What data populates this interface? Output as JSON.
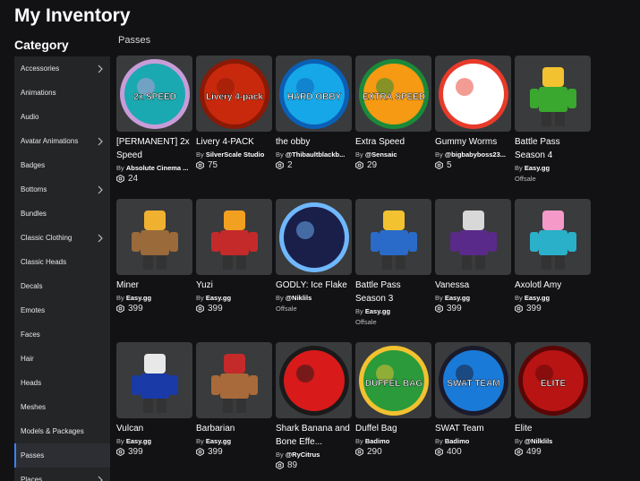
{
  "page": {
    "title": "My Inventory",
    "category_heading": "Category",
    "section_label": "Passes"
  },
  "colors": {
    "background": "#121215",
    "sidebar": "#232527",
    "active_indicator": "#3b82f6",
    "card_bg": "#393b3d"
  },
  "sidebar": {
    "items": [
      {
        "label": "Accessories",
        "chevron": true
      },
      {
        "label": "Animations",
        "chevron": false
      },
      {
        "label": "Audio",
        "chevron": false
      },
      {
        "label": "Avatar Animations",
        "chevron": true
      },
      {
        "label": "Badges",
        "chevron": false
      },
      {
        "label": "Bottoms",
        "chevron": true
      },
      {
        "label": "Bundles",
        "chevron": false
      },
      {
        "label": "Classic Clothing",
        "chevron": true
      },
      {
        "label": "Classic Heads",
        "chevron": false
      },
      {
        "label": "Decals",
        "chevron": false
      },
      {
        "label": "Emotes",
        "chevron": false
      },
      {
        "label": "Faces",
        "chevron": false
      },
      {
        "label": "Hair",
        "chevron": false
      },
      {
        "label": "Heads",
        "chevron": false
      },
      {
        "label": "Meshes",
        "chevron": false
      },
      {
        "label": "Models & Packages",
        "chevron": false
      },
      {
        "label": "Passes",
        "chevron": false,
        "active": true
      },
      {
        "label": "Places",
        "chevron": true
      }
    ]
  },
  "items": [
    {
      "name": "[PERMANENT] 2x Speed",
      "creator": "Absolute Cinema ...",
      "price": "24",
      "thumb_text": "2x SPEED",
      "thumb_color": "#1aa9b0",
      "thumb_accent": "#c89cd8"
    },
    {
      "name": "Livery 4-PACK",
      "creator": "SilverScale Studio",
      "price": "75",
      "thumb_text": "Livery 4-pack",
      "thumb_color": "#c8290c",
      "thumb_accent": "#8a1a06"
    },
    {
      "name": "the obby",
      "creator": "@Thibaultblackb...",
      "price": "2",
      "thumb_text": "HARD OBBY",
      "thumb_color": "#16a7e8",
      "thumb_accent": "#0b5fb5"
    },
    {
      "name": "Extra Speed",
      "creator": "@Sensaic",
      "price": "29",
      "thumb_text": "EXTRA SPEED",
      "thumb_color": "#f59a12",
      "thumb_accent": "#1a8a3a"
    },
    {
      "name": "Gummy Worms",
      "creator": "@bigbabyboss23...",
      "price": "5",
      "thumb_text": "",
      "thumb_color": "#ffffff",
      "thumb_accent": "#e83a2a"
    },
    {
      "name": "Battle Pass Season 4",
      "creator": "Easy.gg",
      "price": "",
      "offsale": "Offsale",
      "thumb_text": "",
      "thumb_color": "#3aa82e",
      "thumb_accent": "#f2c230"
    },
    {
      "name": "Miner",
      "creator": "Easy.gg",
      "price": "399",
      "thumb_text": "",
      "thumb_color": "#9a6a3a",
      "thumb_accent": "#f0b030"
    },
    {
      "name": "Yuzi",
      "creator": "Easy.gg",
      "price": "399",
      "thumb_text": "",
      "thumb_color": "#c42a2a",
      "thumb_accent": "#f2a020"
    },
    {
      "name": "GODLY: Ice Flake",
      "creator": "@Niklils",
      "price": "",
      "offsale": "Offsale",
      "thumb_text": "",
      "thumb_color": "#1a1f4a",
      "thumb_accent": "#6fb8ff"
    },
    {
      "name": "Battle Pass Season 3",
      "creator": "Easy.gg",
      "price": "",
      "offsale": "Offsale",
      "thumb_text": "",
      "thumb_color": "#2a6ac8",
      "thumb_accent": "#f2c230"
    },
    {
      "name": "Vanessa",
      "creator": "Easy.gg",
      "price": "399",
      "thumb_text": "",
      "thumb_color": "#5a2a8a",
      "thumb_accent": "#d8d8d8"
    },
    {
      "name": "Axolotl Amy",
      "creator": "Easy.gg",
      "price": "399",
      "thumb_text": "",
      "thumb_color": "#2ab0c8",
      "thumb_accent": "#f59ac8"
    },
    {
      "name": "Vulcan",
      "creator": "Easy.gg",
      "price": "399",
      "thumb_text": "",
      "thumb_color": "#1a3aa8",
      "thumb_accent": "#e8e8e8"
    },
    {
      "name": "Barbarian",
      "creator": "Easy.gg",
      "price": "399",
      "thumb_text": "",
      "thumb_color": "#a86a3a",
      "thumb_accent": "#c42a2a"
    },
    {
      "name": "Shark Banana and Bone Effe...",
      "creator": "@RyCitrus",
      "price": "89",
      "thumb_text": "",
      "thumb_color": "#d81a1a",
      "thumb_accent": "#1a1a1a"
    },
    {
      "name": "Duffel Bag",
      "creator": "Badimo",
      "price": "290",
      "thumb_text": "DUFFEL BAG",
      "thumb_color": "#2a9a3a",
      "thumb_accent": "#f2c230"
    },
    {
      "name": "SWAT Team",
      "creator": "Badimo",
      "price": "400",
      "thumb_text": "SWAT TEAM",
      "thumb_color": "#1a7ad8",
      "thumb_accent": "#1a1a2a"
    },
    {
      "name": "Elite",
      "creator": "@Nilklils",
      "price": "499",
      "thumb_text": "ELITE",
      "thumb_color": "#b81414",
      "thumb_accent": "#5a0606"
    }
  ]
}
